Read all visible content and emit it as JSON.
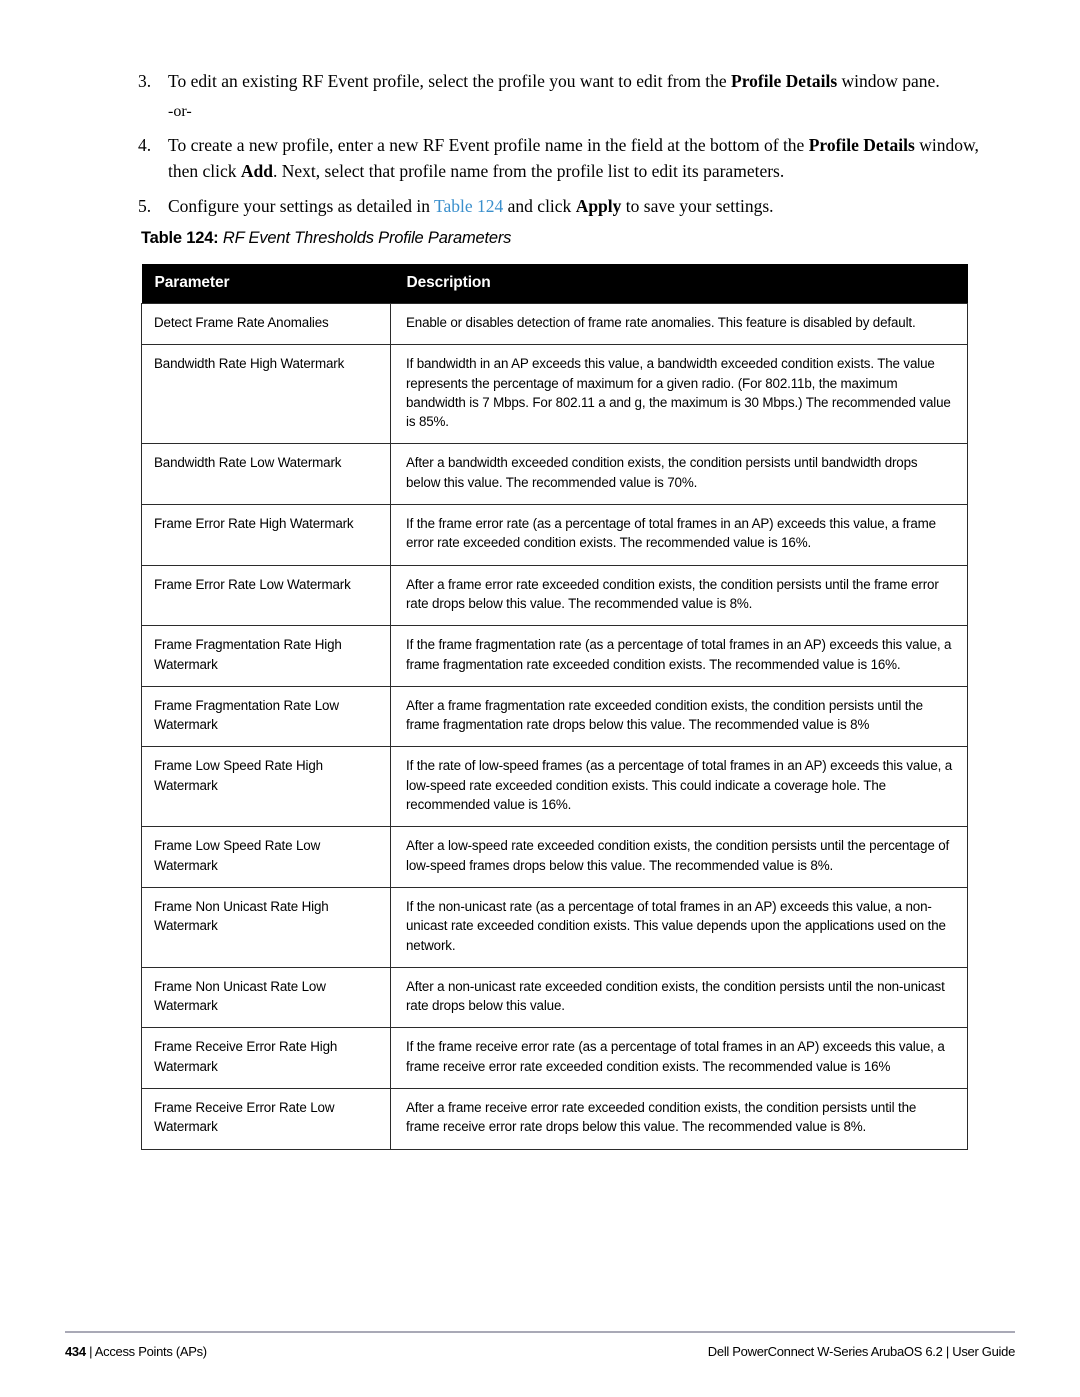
{
  "steps": [
    {
      "number": "3.",
      "segments": [
        {
          "text": "To edit an existing RF Event profile, select the profile you want to edit from the ",
          "style": "normal"
        },
        {
          "text": "Profile Details",
          "style": "bold"
        },
        {
          "text": " window pane.",
          "style": "normal"
        }
      ]
    },
    {
      "number": "4.",
      "segments": [
        {
          "text": "To create a new profile, enter a new RF Event profile name in the field at the bottom of the ",
          "style": "normal"
        },
        {
          "text": "Profile Details",
          "style": "bold"
        },
        {
          "text": " window, then click ",
          "style": "normal"
        },
        {
          "text": "Add",
          "style": "bold"
        },
        {
          "text": ". Next, select that profile name from the profile list to edit its parameters.",
          "style": "normal"
        }
      ]
    },
    {
      "number": "5.",
      "segments": [
        {
          "text": "Configure your settings as detailed in ",
          "style": "normal"
        },
        {
          "text": "Table 124",
          "style": "link"
        },
        {
          "text": " and click ",
          "style": "normal"
        },
        {
          "text": "Apply",
          "style": "bold"
        },
        {
          "text": " to save your settings.",
          "style": "normal"
        }
      ]
    }
  ],
  "or_text": "-or-",
  "table": {
    "caption_label": "Table 124:",
    "caption_title": "RF Event Thresholds Profile Parameters",
    "headers": [
      "Parameter",
      "Description"
    ],
    "rows": [
      {
        "parameter": "Detect Frame Rate Anomalies",
        "description": "Enable or disables detection of frame rate anomalies. This feature is disabled by default."
      },
      {
        "parameter": "Bandwidth Rate High Watermark",
        "description": "If bandwidth in an AP exceeds this value, a bandwidth exceeded condition exists. The value represents the percentage of maximum for a given radio. (For 802.11b, the maximum bandwidth is 7 Mbps. For 802.11 a and g, the maximum is 30 Mbps.) The recommended value is 85%."
      },
      {
        "parameter": "Bandwidth Rate Low Watermark",
        "description": "After a bandwidth exceeded condition exists, the condition persists until bandwidth drops below this value. The recommended value is 70%."
      },
      {
        "parameter": "Frame Error Rate High Watermark",
        "description": "If the frame error rate (as a percentage of total frames in an AP) exceeds this value, a frame error rate exceeded condition exists. The recommended value is 16%."
      },
      {
        "parameter": "Frame Error Rate Low Watermark",
        "description": "After a frame error rate exceeded condition exists, the condition persists until the frame error rate drops below this value. The recommended value is 8%."
      },
      {
        "parameter": "Frame Fragmentation Rate High Watermark",
        "description": "If the frame fragmentation rate (as a percentage of total frames in an AP) exceeds this value, a frame fragmentation rate exceeded condition exists. The recommended value is 16%."
      },
      {
        "parameter": "Frame Fragmentation Rate Low Watermark",
        "description": "After a frame fragmentation rate exceeded condition exists, the condition persists until the frame fragmentation rate drops below this value. The recommended value is 8%"
      },
      {
        "parameter": "Frame Low Speed Rate High Watermark",
        "description": "If the rate of low-speed frames (as a percentage of total frames in an AP) exceeds this value, a low-speed rate exceeded condition exists. This could indicate a coverage hole. The recommended value is 16%."
      },
      {
        "parameter": "Frame Low Speed Rate Low Watermark",
        "description": "After a low-speed rate exceeded condition exists, the condition persists until the percentage of low-speed frames drops below this value. The recommended value is 8%."
      },
      {
        "parameter": "Frame Non Unicast Rate High Watermark",
        "description": "If the non-unicast rate (as a percentage of total frames in an AP) exceeds this value, a non-unicast rate exceeded condition exists. This value depends upon the applications used on the network."
      },
      {
        "parameter": "Frame Non Unicast Rate Low Watermark",
        "description": "After a non-unicast rate exceeded condition exists, the condition persists until the non-unicast rate drops below this value."
      },
      {
        "parameter": "Frame Receive Error Rate High Watermark",
        "description": "If the frame receive error rate (as a percentage of total frames in an AP) exceeds this value, a frame receive error rate exceeded condition exists. The recommended value is 16%"
      },
      {
        "parameter": "Frame Receive Error Rate Low Watermark",
        "description": "After a frame receive error rate exceeded condition exists, the condition persists until the frame receive error rate drops below this value. The recommended value is 8%."
      }
    ]
  },
  "footer": {
    "page_number": "434",
    "left_text": "| Access Points (APs)",
    "right_text": "Dell PowerConnect W-Series ArubaOS 6.2  |  User Guide"
  },
  "colors": {
    "link": "#3a8fcc",
    "header_band": "#000000",
    "border": "#2b2b2b",
    "footer_rule": "#a9a9b6"
  }
}
